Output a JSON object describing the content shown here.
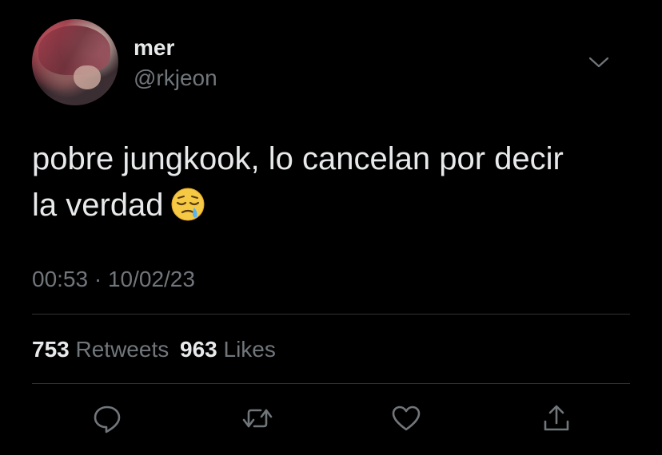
{
  "tweet": {
    "display_name": "mer",
    "handle": "@rkjeon",
    "text_line1": "pobre jungkook, lo cancelan por decir",
    "text_line2": "la verdad",
    "emoji": "sleepy-face",
    "timestamp": "00:53 · 10/02/23",
    "retweets_count": "753",
    "retweets_label": "Retweets",
    "likes_count": "963",
    "likes_label": "Likes"
  },
  "actions": [
    {
      "icon": "reply-icon"
    },
    {
      "icon": "retweet-icon"
    },
    {
      "icon": "like-icon"
    },
    {
      "icon": "share-icon"
    }
  ],
  "colors": {
    "background": "#000000",
    "primary_text": "#e7e9ea",
    "secondary_text": "#71767b",
    "divider": "#2f3336"
  }
}
